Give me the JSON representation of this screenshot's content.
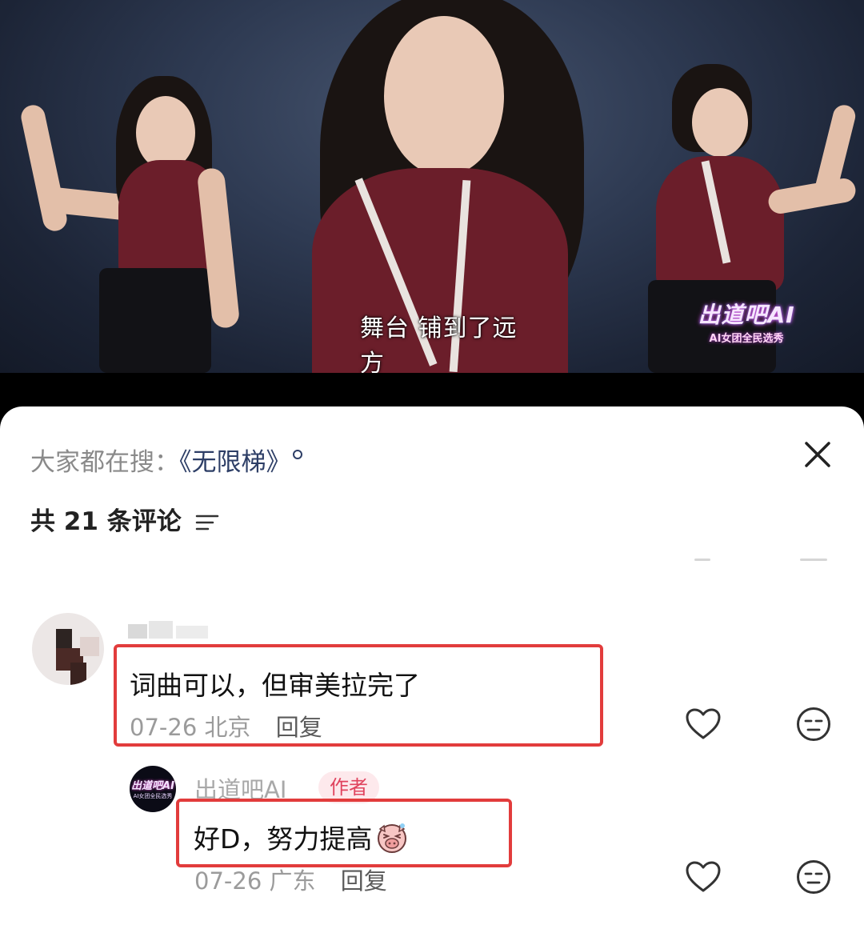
{
  "video": {
    "subtitle": "舞台 铺到了远方",
    "watermark_logo": "出道吧AI",
    "watermark_sub": "AI女团全民选秀"
  },
  "sheet": {
    "hot_search_label": "大家都在搜：",
    "hot_search_term": "《无限梯》",
    "comment_count": "共 21 条评论",
    "icons": {
      "close": "close-icon",
      "filter": "filter-icon",
      "like": "heart-icon",
      "reaction": "emoji-face-icon"
    },
    "comments": [
      {
        "text": "词曲可以，但审美拉完了",
        "date": "07-26",
        "location": "北京",
        "reply_label": "回复",
        "highlight_color": "#e23c3c"
      }
    ],
    "reply": {
      "avatar_logo": "出道吧AI",
      "avatar_sub": "AI女团全民选秀",
      "author": "出道吧AI",
      "badge": "作者",
      "text": "好D，努力提高",
      "date": "07-26",
      "location": "广东",
      "reply_label": "回复",
      "sticker": "pig-face-sticker"
    }
  }
}
